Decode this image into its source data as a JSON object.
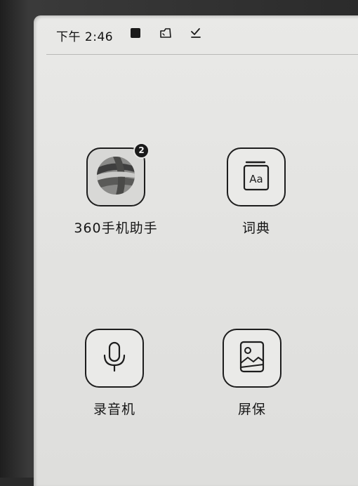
{
  "status_bar": {
    "time": "下午 2:46",
    "icons": [
      "stop-square-icon",
      "folder-check-icon",
      "check-underline-icon"
    ]
  },
  "apps": [
    {
      "label": "360手机助手",
      "icon": "basketball-icon",
      "badge": "2"
    },
    {
      "label": "词典",
      "icon": "dictionary-book-icon"
    },
    {
      "label": "录音机",
      "icon": "microphone-icon"
    },
    {
      "label": "屏保",
      "icon": "picture-frame-icon"
    }
  ],
  "colors": {
    "screen": "#e6e6e4",
    "ink": "#1d1d1d",
    "bezel": "#2a2a2a"
  }
}
